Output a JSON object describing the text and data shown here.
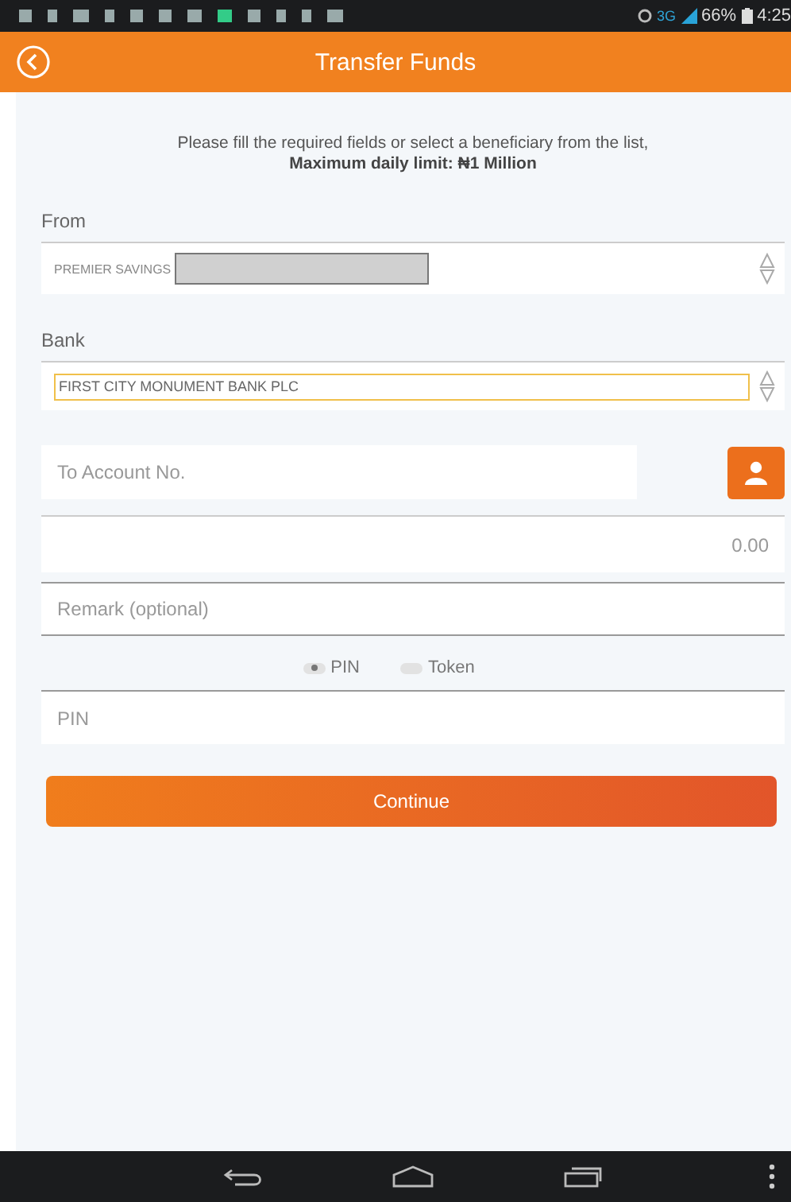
{
  "status_bar": {
    "network": "3G",
    "battery": "66%",
    "time": "4:25"
  },
  "header": {
    "title": "Transfer Funds"
  },
  "intro": {
    "line_1": "Please fill the required fields or select a beneficiary from the list,",
    "line_2": "Maximum daily limit: ₦1 Million"
  },
  "from": {
    "label": "From",
    "value": "PREMIER SAVINGS"
  },
  "bank": {
    "label": "Bank",
    "value": "FIRST CITY MONUMENT BANK PLC",
    "focused": true
  },
  "to_account": {
    "placeholder": "To Account No."
  },
  "amount": {
    "placeholder": "0.00"
  },
  "remark": {
    "placeholder": "Remark (optional)"
  },
  "auth_options": [
    {
      "label": "PIN",
      "selected": true
    },
    {
      "label": "Token",
      "selected": false
    }
  ],
  "pin": {
    "placeholder": "PIN"
  },
  "continue_button": {
    "label": "Continue"
  }
}
